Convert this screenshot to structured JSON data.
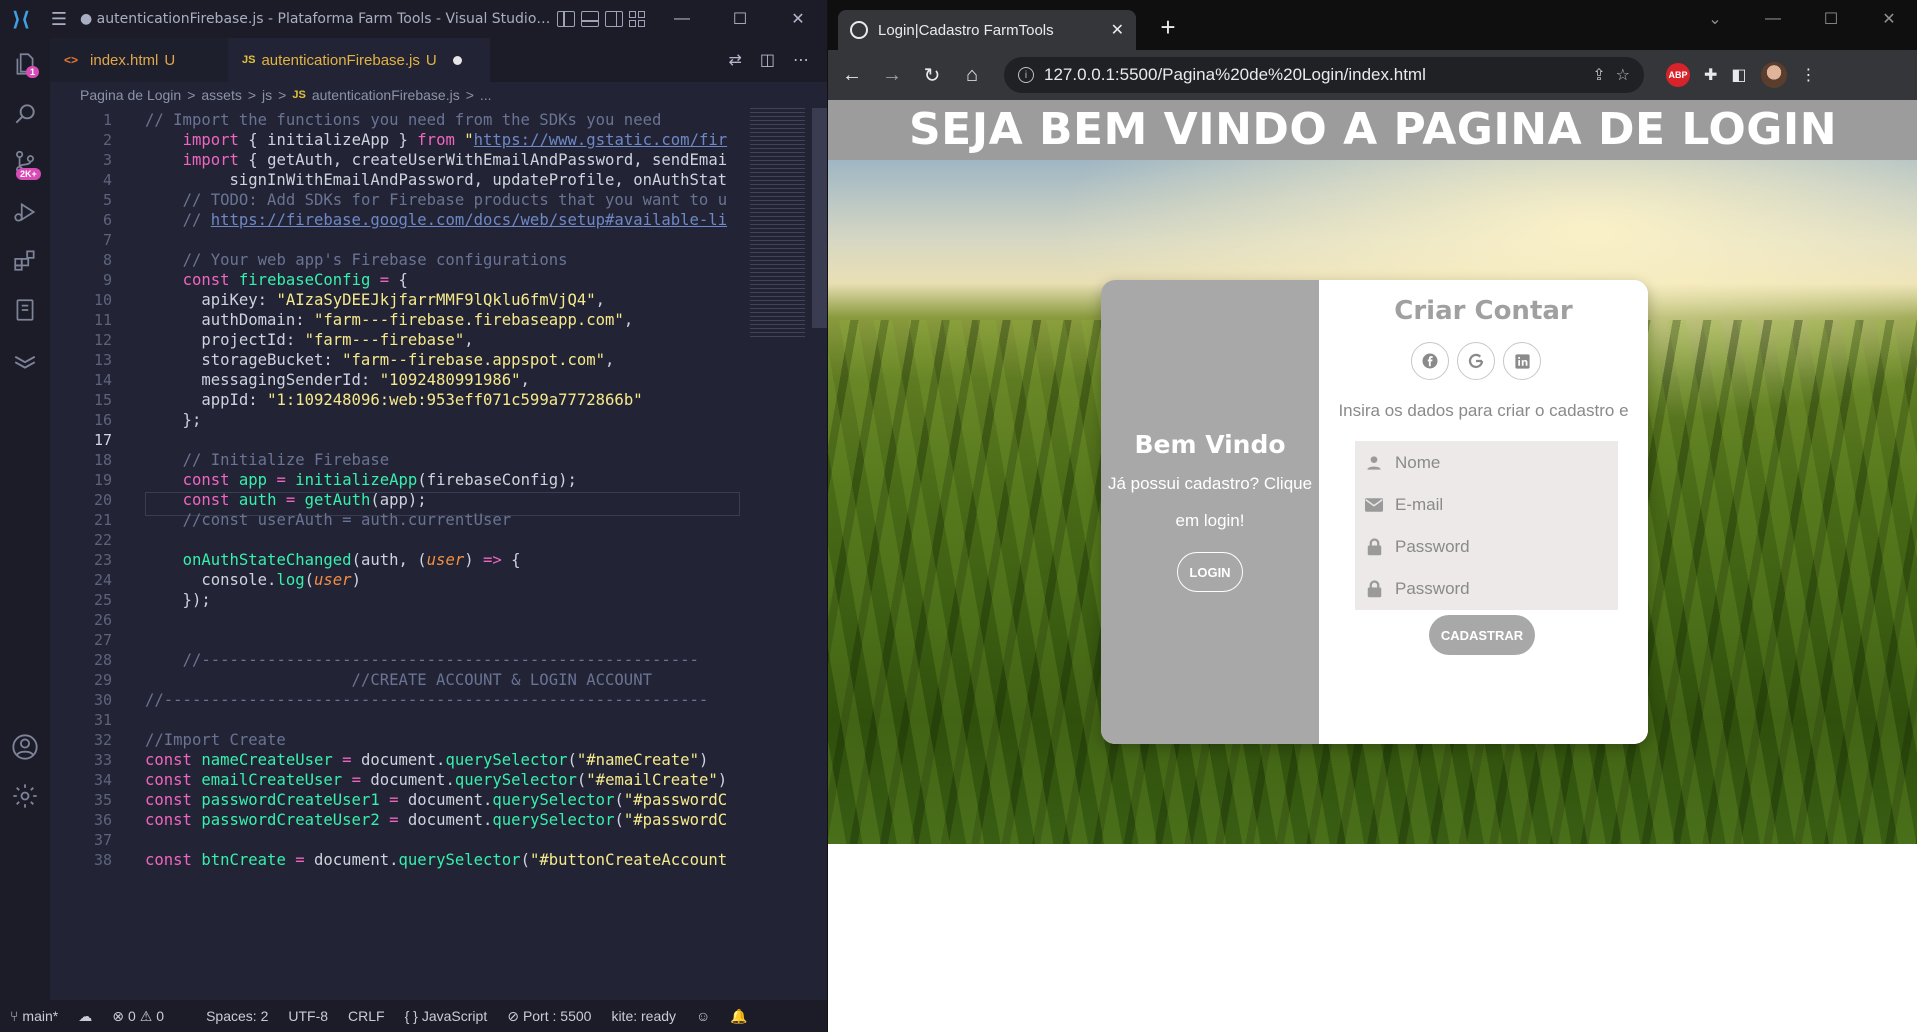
{
  "vscode": {
    "title": "● autenticationFirebase.js - Plataforma Farm Tools - Visual Studio C...",
    "activity_badges": {
      "explorer": "1",
      "scm": "2K+"
    },
    "tabs": [
      {
        "label": "index.html",
        "status": "U",
        "icon": "html-file-icon"
      },
      {
        "label": "autenticationFirebase.js",
        "status": "U",
        "icon": "js-file-icon",
        "active": true,
        "dirty": true
      }
    ],
    "breadcrumb": [
      "Pagina de Login",
      ">",
      "assets",
      ">",
      "js",
      ">",
      "JS",
      "autenticationFirebase.js",
      ">",
      "..."
    ],
    "current_line": 17,
    "status": {
      "branch": "main*",
      "errors": "0",
      "warnings": "0",
      "spaces": "Spaces: 2",
      "encoding": "UTF-8",
      "eol": "CRLF",
      "language": "JavaScript",
      "port": "Port : 5500",
      "kite": "kite: ready"
    },
    "colors": {
      "accent": "#3f9fe5",
      "badge": "#d84bb6",
      "keyword": "#f065c0",
      "string": "#f5e98c",
      "function": "#36f0ad"
    }
  },
  "browser": {
    "tab_title": "Login|Cadastro FarmTools",
    "url": "127.0.0.1:5500/Pagina%20de%20Login/index.html",
    "extensions": [
      "share-icon",
      "star-icon",
      "abp-icon",
      "puzzle-icon",
      "sidepanel-icon",
      "avatar",
      "kebab-icon"
    ],
    "abp_label": "ABP",
    "page": {
      "hero_title": "SEJA BEM VINDO A PAGINA DE LOGIN",
      "left_panel": {
        "heading": "Bem Vindo",
        "text": "Já possui cadastro? Clique em login!",
        "button": "LOGIN"
      },
      "right_panel": {
        "heading": "Criar Contar",
        "socials": [
          "facebook-icon",
          "google-icon",
          "linkedin-icon"
        ],
        "description": "Insira os dados para criar o cadastro e login",
        "fields": [
          {
            "placeholder": "Nome",
            "icon": "user-icon"
          },
          {
            "placeholder": "E-mail",
            "icon": "envelope-icon"
          },
          {
            "placeholder": "Password",
            "icon": "lock-icon"
          },
          {
            "placeholder": "Password",
            "icon": "lock-icon"
          }
        ],
        "button": "CADASTRAR"
      }
    }
  }
}
